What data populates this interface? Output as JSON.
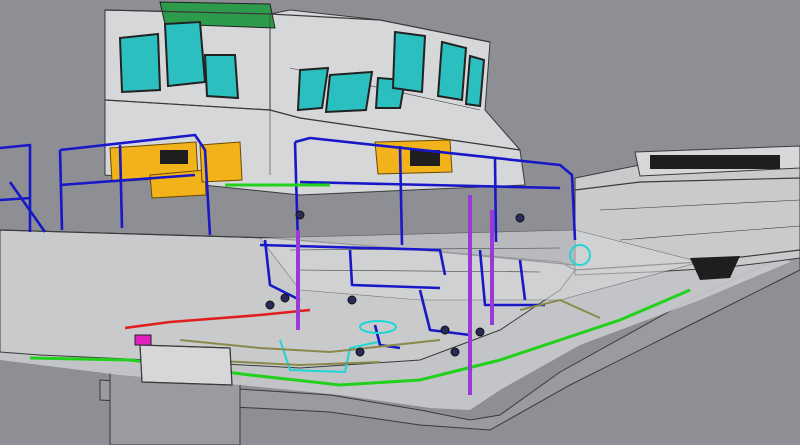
{
  "viewport": {
    "background": "#8d8f94"
  },
  "model": {
    "hull_color": "#c9cacc",
    "hull_dark": "#9a9b9e",
    "structure_color": "#d6d7d9",
    "edge_color": "#3a3a3a",
    "glass_color": "#2bc0bf",
    "railing_color": "#1818c8",
    "pipe_purple": "#9a3ad6",
    "pipe_green": "#22d11c",
    "pipe_red": "#e01e1e",
    "pipe_cyan": "#1fd6d6",
    "pipe_olive": "#8a8a4a",
    "vent_yellow": "#f2b21a",
    "roof_green": "#2c9b4b",
    "valve_magenta": "#e020c0"
  }
}
